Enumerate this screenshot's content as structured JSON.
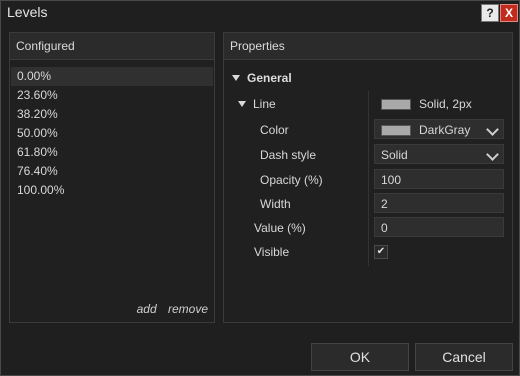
{
  "window": {
    "title": "Levels",
    "help_label": "?",
    "close_label": "X"
  },
  "configured": {
    "header": "Configured",
    "items": [
      "0.00%",
      "23.60%",
      "38.20%",
      "50.00%",
      "61.80%",
      "76.40%",
      "100.00%"
    ],
    "selected_index": 0,
    "add_label": "add",
    "remove_label": "remove"
  },
  "properties": {
    "header": "Properties",
    "section": "General",
    "line_label": "Line",
    "line_value": "Solid, 2px",
    "color_label": "Color",
    "color_value": "DarkGray",
    "dash_label": "Dash style",
    "dash_value": "Solid",
    "opacity_label": "Opacity (%)",
    "opacity_value": "100",
    "width_label": "Width",
    "width_value": "2",
    "value_label": "Value (%)",
    "value_value": "0",
    "visible_label": "Visible",
    "visible_checked": true,
    "checkmark": "✔"
  },
  "buttons": {
    "ok": "OK",
    "cancel": "Cancel"
  },
  "colors": {
    "swatch": "#a9a9a9",
    "close_button": "#c22c1f",
    "background": "#1f1f1f"
  },
  "icons": {
    "help": "help-icon",
    "close": "close-icon",
    "expand": "triangle-down-icon",
    "dropdown": "chevron-down-icon",
    "check": "checkmark-icon"
  }
}
